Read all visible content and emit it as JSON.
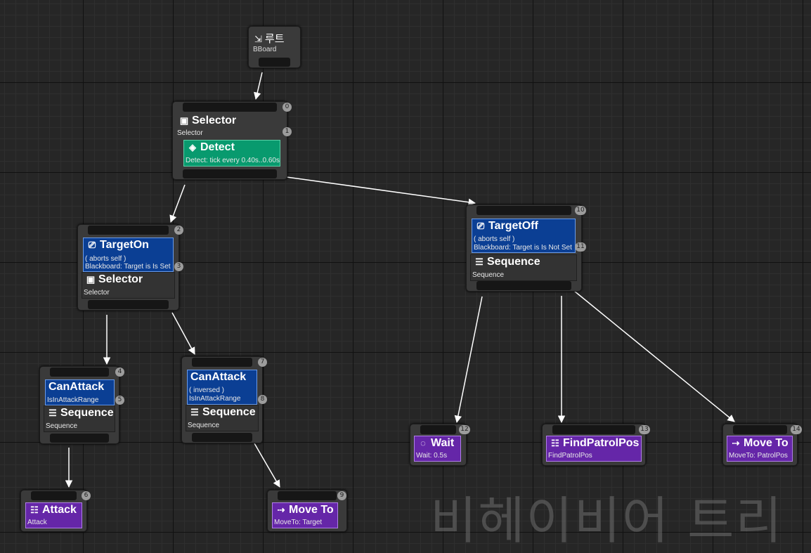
{
  "root": {
    "title": "루트",
    "sub": "BBoard",
    "icon": "root-icon"
  },
  "nodes": {
    "selector0": {
      "index": "0",
      "title": "Selector",
      "sub": "Selector",
      "icon": "selector-icon"
    },
    "detect": {
      "index": "1",
      "title": "Detect",
      "sub": "Detect: tick every 0.40s..0.60s",
      "icon": "service-icon",
      "color": "#089a6e"
    },
    "targeton": {
      "index": "2",
      "title": "TargetOn",
      "line1": "( aborts self )",
      "line2": "Blackboard: Target is Is Set",
      "icon": "decorator-icon",
      "color": "#0b3f94"
    },
    "selector3": {
      "index": "3",
      "title": "Selector",
      "sub": "Selector",
      "icon": "selector-icon"
    },
    "canattack4": {
      "index": "4",
      "title": "CanAttack",
      "sub": "IsInAttackRange",
      "icon": "decorator-icon"
    },
    "sequence5": {
      "index": "5",
      "title": "Sequence",
      "sub": "Sequence",
      "icon": "sequence-icon"
    },
    "attack6": {
      "index": "6",
      "title": "Attack",
      "sub": "Attack",
      "icon": "task-icon",
      "color": "#6526a8"
    },
    "canattack7": {
      "index": "7",
      "title": "CanAttack",
      "line1": "( inversed )",
      "line2": "IsInAttackRange",
      "icon": "decorator-icon"
    },
    "sequence8": {
      "index": "8",
      "title": "Sequence",
      "sub": "Sequence",
      "icon": "sequence-icon"
    },
    "moveto9": {
      "index": "9",
      "title": "Move To",
      "sub": "MoveTo: Target",
      "icon": "moveto-icon"
    },
    "targetoff": {
      "index": "10",
      "title": "TargetOff",
      "line1": "( aborts self )",
      "line2": "Blackboard: Target is Is Not Set",
      "icon": "decorator-icon"
    },
    "sequence11": {
      "index": "11",
      "title": "Sequence",
      "sub": "Sequence",
      "icon": "sequence-icon"
    },
    "wait12": {
      "index": "12",
      "title": "Wait",
      "sub": "Wait: 0.5s",
      "icon": "wait-icon"
    },
    "findpatrol13": {
      "index": "13",
      "title": "FindPatrolPos",
      "sub": "FindPatrolPos",
      "icon": "task-icon"
    },
    "moveto14": {
      "index": "14",
      "title": "Move To",
      "sub": "MoveTo: PatrolPos",
      "icon": "moveto-icon"
    }
  },
  "watermark": "비헤이비어 트리",
  "colors": {
    "grid_bg": "#262626",
    "composite": "#333333",
    "service": "#089a6e",
    "decorator": "#0b3f94",
    "task": "#6526a8",
    "edge": "#ffffff"
  }
}
